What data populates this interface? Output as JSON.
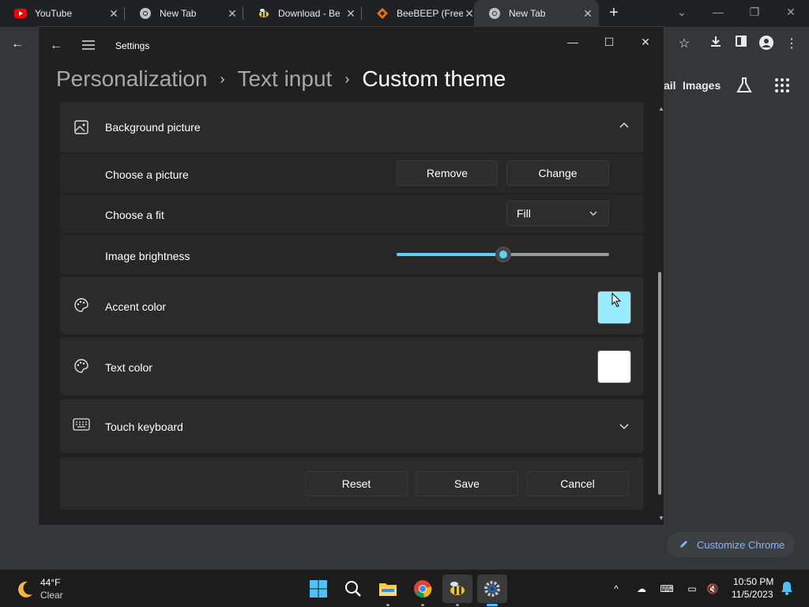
{
  "browser": {
    "tabs": [
      {
        "title": "YouTube",
        "icon": "youtube-icon"
      },
      {
        "title": "New Tab",
        "icon": "chrome-icon"
      },
      {
        "title": "Download - Be",
        "icon": "beebeep-icon"
      },
      {
        "title": "BeeBEEP (Free",
        "icon": "beebeep-site-icon"
      },
      {
        "title": "New Tab",
        "icon": "chrome-icon"
      }
    ],
    "ntp_links": {
      "gmail_partial": "ail",
      "images": "Images"
    },
    "customize_label": "Customize Chrome"
  },
  "settings": {
    "window_title": "Settings",
    "breadcrumb": [
      "Personalization",
      "Text input",
      "Custom theme"
    ],
    "background_picture": {
      "label": "Background picture",
      "choose_picture_label": "Choose a picture",
      "remove_label": "Remove",
      "change_label": "Change",
      "choose_fit_label": "Choose a fit",
      "fit_value": "Fill",
      "brightness_label": "Image brightness",
      "brightness_fraction": 0.5
    },
    "accent_color": {
      "label": "Accent color",
      "value": "#99ebff"
    },
    "text_color": {
      "label": "Text color",
      "value": "#ffffff"
    },
    "touch_keyboard": {
      "label": "Touch keyboard"
    },
    "footer": {
      "reset_label": "Reset",
      "save_label": "Save",
      "cancel_label": "Cancel"
    }
  },
  "taskbar": {
    "weather_temp": "44°F",
    "weather_condition": "Clear",
    "time": "10:50 PM",
    "date": "11/5/2023"
  },
  "colors": {
    "accent": "#60cdff",
    "window_bg": "#202020",
    "card_bg": "#2b2b2b"
  }
}
